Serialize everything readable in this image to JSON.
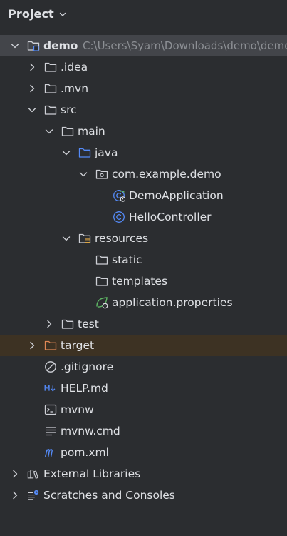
{
  "panel": {
    "title": "Project"
  },
  "tree": [
    {
      "label": "demo",
      "path": "C:\\Users\\Syam\\Downloads\\demo\\demo",
      "bold": true,
      "depth": 0,
      "arrow": "down",
      "icon": "module-folder-icon",
      "selected": true
    },
    {
      "label": ".idea",
      "depth": 1,
      "arrow": "right",
      "icon": "folder-icon"
    },
    {
      "label": ".mvn",
      "depth": 1,
      "arrow": "right",
      "icon": "folder-icon"
    },
    {
      "label": "src",
      "depth": 1,
      "arrow": "down",
      "icon": "folder-icon"
    },
    {
      "label": "main",
      "depth": 2,
      "arrow": "down",
      "icon": "folder-icon"
    },
    {
      "label": "java",
      "depth": 3,
      "arrow": "down",
      "icon": "source-folder-icon"
    },
    {
      "label": "com.example.demo",
      "depth": 4,
      "arrow": "down",
      "icon": "package-icon"
    },
    {
      "label": "DemoApplication",
      "depth": 5,
      "icon": "spring-class-icon"
    },
    {
      "label": "HelloController",
      "depth": 5,
      "icon": "class-icon"
    },
    {
      "label": "resources",
      "depth": 3,
      "arrow": "down",
      "icon": "resources-folder-icon"
    },
    {
      "label": "static",
      "depth": 4,
      "icon": "folder-icon"
    },
    {
      "label": "templates",
      "depth": 4,
      "icon": "folder-icon"
    },
    {
      "label": "application.properties",
      "depth": 4,
      "icon": "spring-properties-icon"
    },
    {
      "label": "test",
      "depth": 2,
      "arrow": "right",
      "icon": "folder-icon"
    },
    {
      "label": "target",
      "depth": 1,
      "arrow": "right",
      "icon": "excluded-folder-icon",
      "excluded": true
    },
    {
      "label": ".gitignore",
      "depth": 1,
      "icon": "ignore-file-icon"
    },
    {
      "label": "HELP.md",
      "depth": 1,
      "icon": "markdown-icon"
    },
    {
      "label": "mvnw",
      "depth": 1,
      "icon": "shell-script-icon"
    },
    {
      "label": "mvnw.cmd",
      "depth": 1,
      "icon": "text-file-icon"
    },
    {
      "label": "pom.xml",
      "depth": 1,
      "icon": "maven-icon"
    },
    {
      "label": "External Libraries",
      "depth": 0,
      "arrow": "right",
      "icon": "libraries-icon"
    },
    {
      "label": "Scratches and Consoles",
      "depth": 0,
      "arrow": "right",
      "icon": "scratches-icon"
    }
  ],
  "colors": {
    "background": "#2b2d30",
    "text": "#dfe1e5",
    "muted": "#8c8f94",
    "selected_row": "#43454a",
    "excluded_row": "#3d3223",
    "folder": "#ced0d6",
    "source_folder": "#548af7",
    "excluded_folder": "#e08855",
    "class": "#548af7",
    "spring": "#5fb865"
  }
}
